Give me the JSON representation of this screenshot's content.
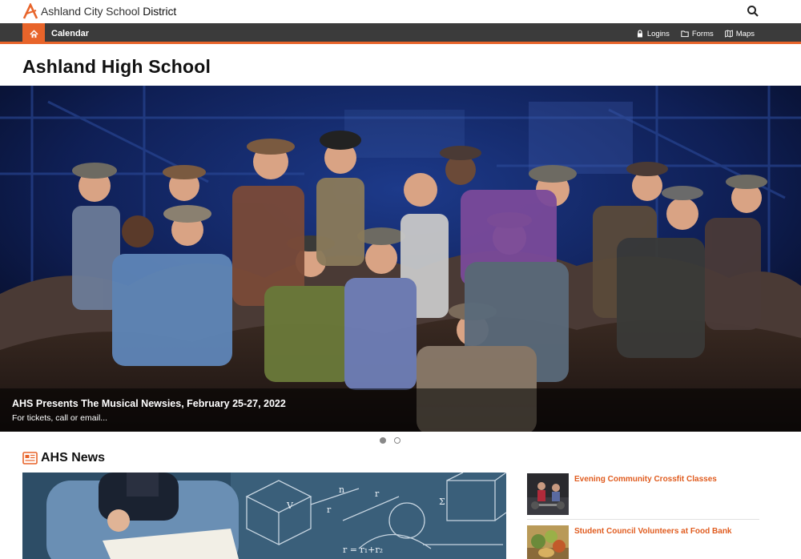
{
  "brand": {
    "name_light": "Ashland City School",
    "name_bold": "District"
  },
  "nav": {
    "calendar_label": "Calendar",
    "links": [
      {
        "label": "Logins",
        "icon": "lock-icon"
      },
      {
        "label": "Forms",
        "icon": "folder-icon"
      },
      {
        "label": "Maps",
        "icon": "map-icon"
      }
    ]
  },
  "page": {
    "title": "Ashland High School"
  },
  "hero": {
    "title": "AHS Presents The Musical Newsies, February 25-27, 2022",
    "subtitle": "For tickets, call or email...",
    "slides_count": 2,
    "active_slide": 1
  },
  "news": {
    "heading": "AHS News",
    "items": [
      {
        "title": "Evening Community Crossfit Classes"
      },
      {
        "title": "Student Council Volunteers at Food Bank"
      }
    ]
  },
  "colors": {
    "accent": "#e8642a",
    "nav_bg": "#3b3b3b",
    "link": "#e05c1f"
  }
}
